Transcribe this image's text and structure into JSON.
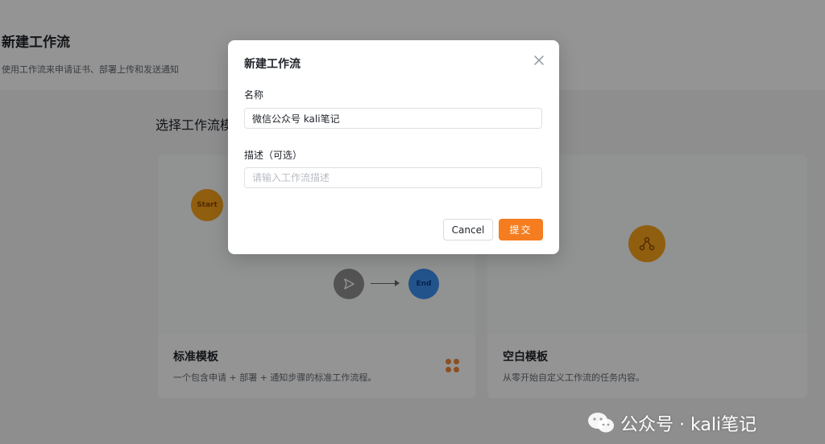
{
  "page": {
    "title": "新建工作流",
    "subtitle": "使用工作流来申请证书、部署上传和发送通知",
    "section_title": "选择工作流模板"
  },
  "templates": [
    {
      "name": "标准模板",
      "description": "一个包含申请 + 部署 + 通知步骤的标准工作流程。",
      "preview_nodes": {
        "start": "Start",
        "end": "End"
      }
    },
    {
      "name": "空白模板",
      "description": "从零开始自定义工作流的任务内容。"
    }
  ],
  "modal": {
    "title": "新建工作流",
    "name_label": "名称",
    "name_value": "微信公众号 kali笔记",
    "desc_label": "描述（可选）",
    "desc_placeholder": "请输入工作流描述",
    "cancel_label": "Cancel",
    "submit_label": "提交"
  },
  "watermark": {
    "text": "公众号 · kali笔记"
  },
  "colors": {
    "accent": "#f57d1f",
    "start_node": "#f8a21b",
    "end_node": "#3d8ff0"
  }
}
